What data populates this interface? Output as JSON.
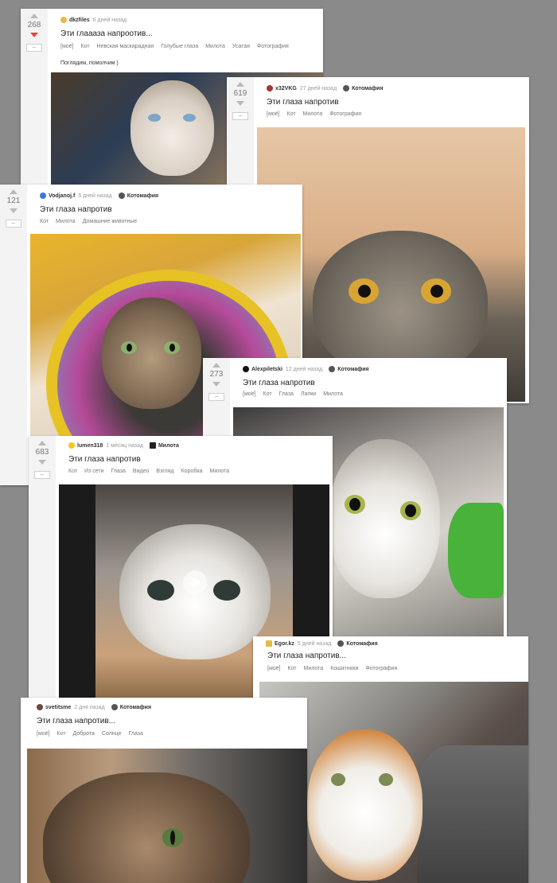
{
  "posts": [
    {
      "votes": "268",
      "author": "dkzfiles",
      "time": "6 дней назад",
      "community": "",
      "title": "Эти глаааза напроотив...",
      "tags": [
        "[моё]",
        "Кот",
        "Невская маскарадная",
        "Голубые глаза",
        "Милота",
        "Усатая",
        "Фотография"
      ],
      "text": "Поглядим, помолчим )"
    },
    {
      "votes": "619",
      "author": "x32VKG",
      "time": "27 дней назад",
      "community": "Котомафия",
      "title": "Эти глаза напротив",
      "tags": [
        "[моё]",
        "Кот",
        "Милота",
        "Фотография"
      ]
    },
    {
      "votes": "121",
      "author": "Vodjanoj.f",
      "time": "5 дней назад",
      "community": "Котомафия",
      "title": "Эти глаза напротив",
      "tags": [
        "Кот",
        "Милота",
        "Домашние животные"
      ]
    },
    {
      "votes": "273",
      "author": "Alexpiletski",
      "time": "12 дней назад",
      "community": "Котомафия",
      "title": "Эти глаза напротив",
      "tags": [
        "[моё]",
        "Кот",
        "Глаза",
        "Лапки",
        "Милота"
      ]
    },
    {
      "votes": "683",
      "author": "lumen318",
      "time": "1 месяц назад",
      "community": "Милота",
      "title": "Эти глаза напротив",
      "tags": [
        "Кот",
        "Из сети",
        "Глаза",
        "Видео",
        "Взгляд",
        "Коробка",
        "Милота"
      ]
    },
    {
      "votes": "",
      "author": "Egor.kz",
      "time": "5 дней назад",
      "community": "Котомафия",
      "title": "Эти глаза напротив...",
      "tags": [
        "[моё]",
        "Кот",
        "Милота",
        "Кошатники",
        "Фотография"
      ]
    },
    {
      "votes": "",
      "author": "svetitsme",
      "time": "2 дня назад",
      "community": "Котомафия",
      "title": "Эти глаза напротив...",
      "tags": [
        "[моё]",
        "Кот",
        "Доброта",
        "Солнце",
        "Глаза"
      ]
    }
  ],
  "ui": {
    "minus_glyph": "–"
  },
  "colors": {
    "background": "#8a8a8a",
    "downvote_active": "#e5473a"
  }
}
